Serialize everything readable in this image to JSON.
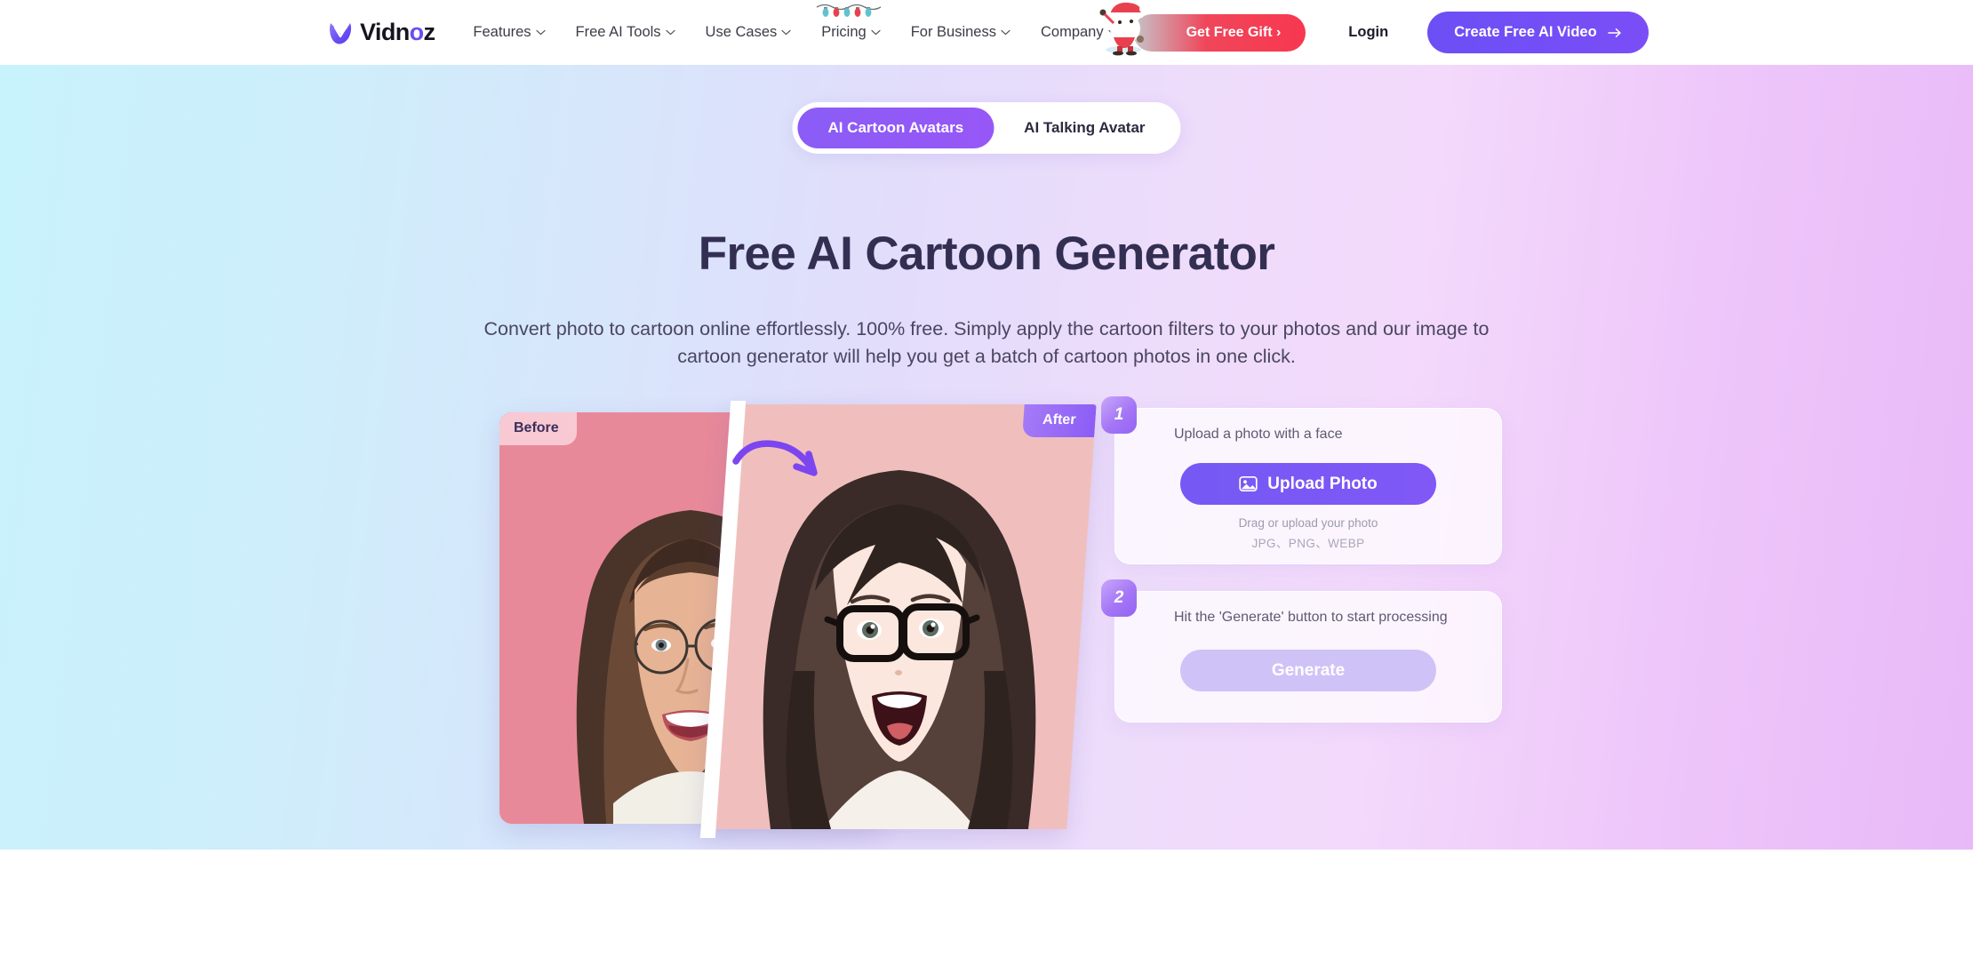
{
  "brand": {
    "name": "Vidnoz",
    "logo_icon": "vidnoz-v-logo-icon",
    "accent": "#6a4df4"
  },
  "header": {
    "nav": [
      {
        "label": "Features",
        "icon": "chevron-down-icon",
        "decoration": null
      },
      {
        "label": "Free AI Tools",
        "icon": "chevron-down-icon",
        "decoration": null
      },
      {
        "label": "Use Cases",
        "icon": "chevron-down-icon",
        "decoration": null
      },
      {
        "label": "Pricing",
        "icon": "chevron-down-icon",
        "decoration": "christmas-lights-icon"
      },
      {
        "label": "For Business",
        "icon": "chevron-down-icon",
        "decoration": null
      },
      {
        "label": "Company",
        "icon": "chevron-down-icon",
        "decoration": null
      }
    ],
    "gift_button": {
      "label": "Get Free Gift ›",
      "icon": "santa-claus-icon",
      "color": "#f8374f"
    },
    "login_label": "Login",
    "cta_button": {
      "label": "Create Free AI Video",
      "icon": "arrow-right-icon",
      "color": "#6b4ff5"
    }
  },
  "hero": {
    "tabs": [
      {
        "label": "AI Cartoon Avatars",
        "active": true
      },
      {
        "label": "AI Talking Avatar",
        "active": false
      }
    ],
    "title": "Free AI Cartoon Generator",
    "subtitle": "Convert photo to cartoon online effortlessly. 100% free. Simply apply the cartoon filters to your photos and our image to cartoon generator will help you get a batch of cartoon photos in one click.",
    "comparison": {
      "before_label": "Before",
      "after_label": "After",
      "arrow_icon": "curved-arrow-right-icon",
      "before_image": "photo-of-woman-with-round-glasses-smiling",
      "after_image": "cartoon-avatar-of-woman-with-black-glasses"
    },
    "steps": [
      {
        "number": "1",
        "label": "Upload a photo with a face",
        "button": {
          "label": "Upload Photo",
          "icon": "image-upload-icon",
          "disabled": false
        },
        "hint": "Drag or upload your photo",
        "formats": "JPG、PNG、WEBP"
      },
      {
        "number": "2",
        "label": "Hit the 'Generate' button to start processing",
        "button": {
          "label": "Generate",
          "icon": null,
          "disabled": true
        },
        "hint": null,
        "formats": null
      }
    ]
  }
}
